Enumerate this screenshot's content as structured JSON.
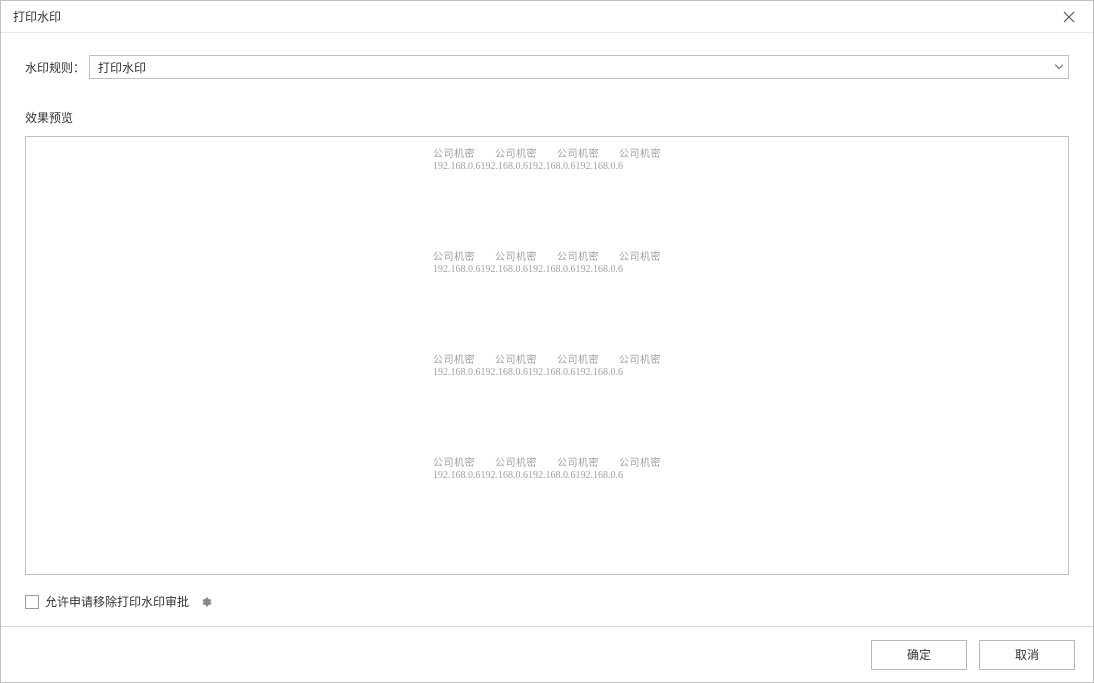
{
  "dialog": {
    "title": "打印水印"
  },
  "form": {
    "rule_label": "水印规则：",
    "rule_selected": "打印水印"
  },
  "preview": {
    "label": "效果预览",
    "watermark_text": "公司机密",
    "watermark_ip": "192.168.0.6"
  },
  "checkbox": {
    "label": "允许申请移除打印水印审批"
  },
  "footer": {
    "ok": "确定",
    "cancel": "取消"
  }
}
